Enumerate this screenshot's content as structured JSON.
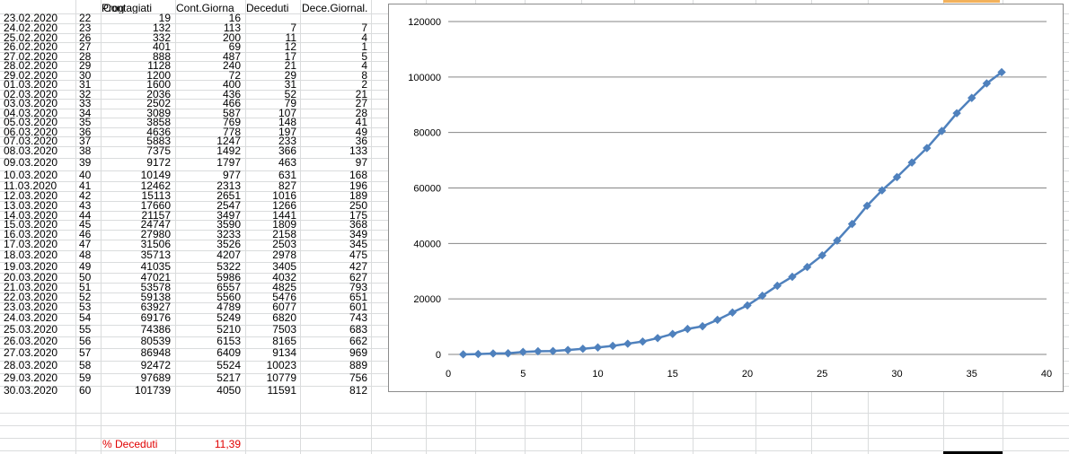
{
  "sheet": {
    "headers": [
      "",
      "Prog",
      "Contagiati",
      "Cont.Giorna",
      "Deceduti",
      "Dece.Giornal."
    ],
    "rows": [
      [
        "23.02.2020",
        "22",
        "19",
        "16",
        "",
        ""
      ],
      [
        "24.02.2020",
        "23",
        "132",
        "113",
        "7",
        "7"
      ],
      [
        "25.02.2020",
        "26",
        "332",
        "200",
        "11",
        "4"
      ],
      [
        "26.02.2020",
        "27",
        "401",
        "69",
        "12",
        "1"
      ],
      [
        "27.02.2020",
        "28",
        "888",
        "487",
        "17",
        "5"
      ],
      [
        "28.02.2020",
        "29",
        "1128",
        "240",
        "21",
        "4"
      ],
      [
        "29.02.2020",
        "30",
        "1200",
        "72",
        "29",
        "8"
      ],
      [
        "01.03.2020",
        "31",
        "1600",
        "400",
        "31",
        "2"
      ],
      [
        "02.03.2020",
        "32",
        "2036",
        "436",
        "52",
        "21"
      ],
      [
        "03.03.2020",
        "33",
        "2502",
        "466",
        "79",
        "27"
      ],
      [
        "04.03.2020",
        "34",
        "3089",
        "587",
        "107",
        "28"
      ],
      [
        "05.03.2020",
        "35",
        "3858",
        "769",
        "148",
        "41"
      ],
      [
        "06.03.2020",
        "36",
        "4636",
        "778",
        "197",
        "49"
      ],
      [
        "07.03.2020",
        "37",
        "5883",
        "1247",
        "233",
        "36"
      ],
      [
        "08.03.2020",
        "38",
        "7375",
        "1492",
        "366",
        "133"
      ],
      [
        "09.03.2020",
        "39",
        "9172",
        "1797",
        "463",
        "97"
      ],
      [
        "10.03.2020",
        "40",
        "10149",
        "977",
        "631",
        "168"
      ],
      [
        "11.03.2020",
        "41",
        "12462",
        "2313",
        "827",
        "196"
      ],
      [
        "12.03.2020",
        "42",
        "15113",
        "2651",
        "1016",
        "189"
      ],
      [
        "13.03.2020",
        "43",
        "17660",
        "2547",
        "1266",
        "250"
      ],
      [
        "14.03.2020",
        "44",
        "21157",
        "3497",
        "1441",
        "175"
      ],
      [
        "15.03.2020",
        "45",
        "24747",
        "3590",
        "1809",
        "368"
      ],
      [
        "16.03.2020",
        "46",
        "27980",
        "3233",
        "2158",
        "349"
      ],
      [
        "17.03.2020",
        "47",
        "31506",
        "3526",
        "2503",
        "345"
      ],
      [
        "18.03.2020",
        "48",
        "35713",
        "4207",
        "2978",
        "475"
      ],
      [
        "19.03.2020",
        "49",
        "41035",
        "5322",
        "3405",
        "427"
      ],
      [
        "20.03.2020",
        "50",
        "47021",
        "5986",
        "4032",
        "627"
      ],
      [
        "21.03.2020",
        "51",
        "53578",
        "6557",
        "4825",
        "793"
      ],
      [
        "22.03.2020",
        "52",
        "59138",
        "5560",
        "5476",
        "651"
      ],
      [
        "23.03.2020",
        "53",
        "63927",
        "4789",
        "6077",
        "601"
      ],
      [
        "24.03.2020",
        "54",
        "69176",
        "5249",
        "6820",
        "743"
      ],
      [
        "25.03.2020",
        "55",
        "74386",
        "5210",
        "7503",
        "683"
      ],
      [
        "26.03.2020",
        "56",
        "80539",
        "6153",
        "8165",
        "662"
      ],
      [
        "27.03.2020",
        "57",
        "86948",
        "6409",
        "9134",
        "969"
      ],
      [
        "28.03.2020",
        "58",
        "92472",
        "5524",
        "10023",
        "889"
      ],
      [
        "29.03.2020",
        "59",
        "97689",
        "5217",
        "10779",
        "756"
      ],
      [
        "30.03.2020",
        "60",
        "101739",
        "4050",
        "11591",
        "812"
      ]
    ],
    "footer": {
      "label": "% Deceduti",
      "value": "11,39"
    }
  },
  "chart_data": {
    "type": "scatter",
    "title": "",
    "xlabel": "",
    "ylabel": "",
    "xlim": [
      0,
      40
    ],
    "ylim": [
      0,
      120000
    ],
    "xticks": [
      0,
      5,
      10,
      15,
      20,
      25,
      30,
      35,
      40
    ],
    "yticks": [
      0,
      20000,
      40000,
      60000,
      80000,
      100000,
      120000
    ],
    "grid": true,
    "legend": "none",
    "color": "#4f81bd",
    "series": [
      {
        "x": [
          1,
          2,
          3,
          4,
          5,
          6,
          7,
          8,
          9,
          10,
          11,
          12,
          13,
          14,
          15,
          16,
          17,
          18,
          19,
          20,
          21,
          22,
          23,
          24,
          25,
          26,
          27,
          28,
          29,
          30,
          31,
          32,
          33,
          34,
          35,
          36,
          37
        ],
        "y": [
          19,
          132,
          332,
          401,
          888,
          1128,
          1200,
          1600,
          2036,
          2502,
          3089,
          3858,
          4636,
          5883,
          7375,
          9172,
          10149,
          12462,
          15113,
          17660,
          21157,
          24747,
          27980,
          31506,
          35713,
          41035,
          47021,
          53578,
          59138,
          63927,
          69176,
          74386,
          80539,
          86948,
          92472,
          97689,
          101739
        ]
      }
    ]
  }
}
